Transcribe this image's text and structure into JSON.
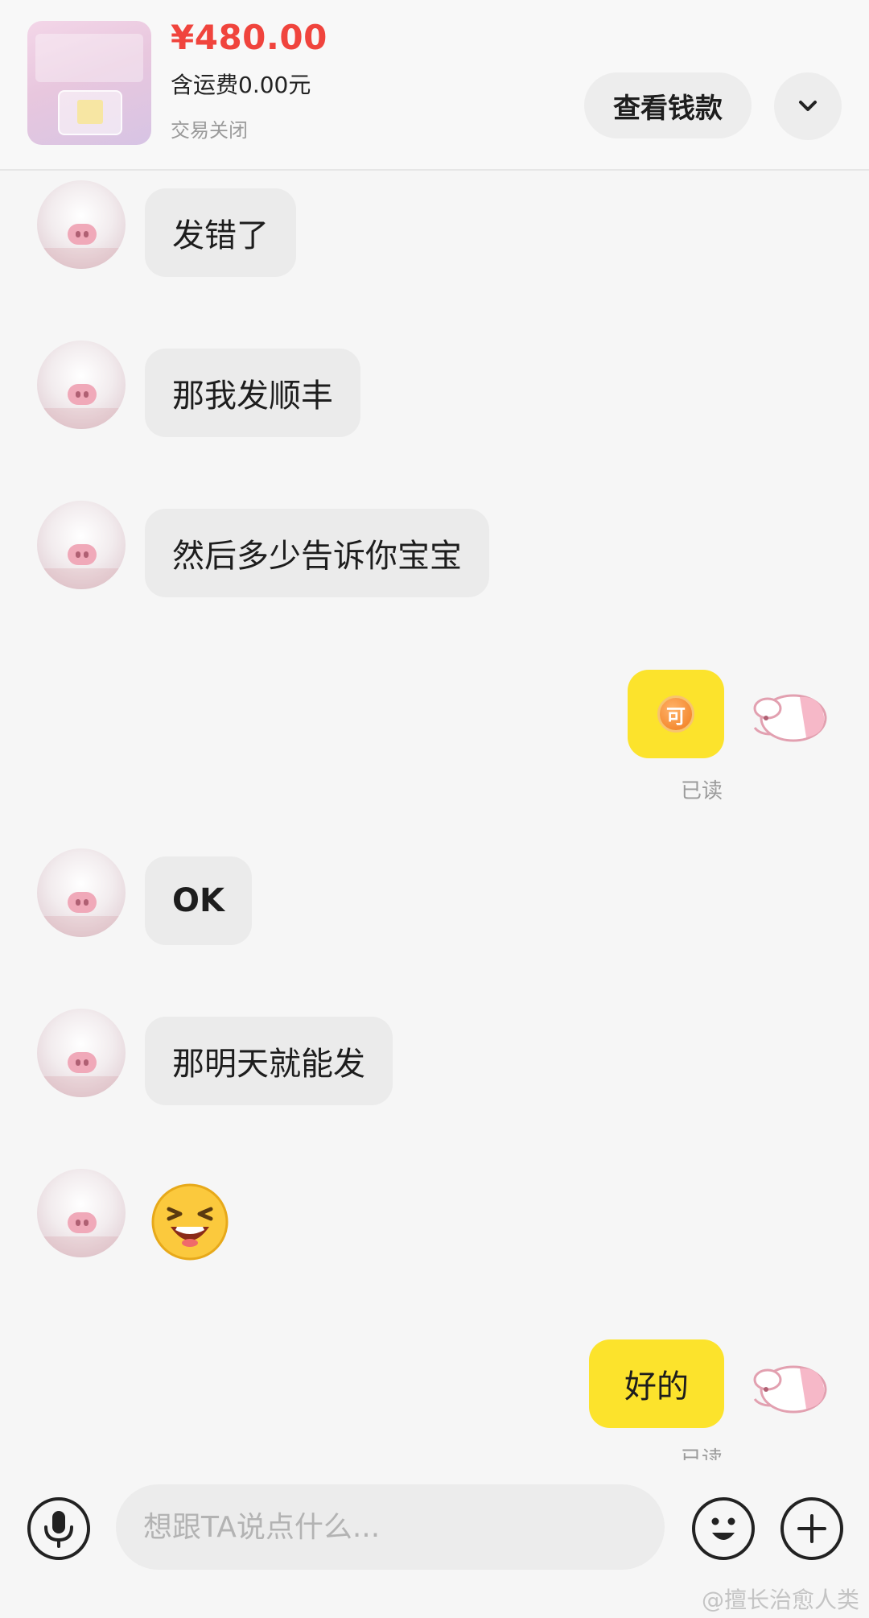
{
  "order": {
    "price": "¥480.00",
    "shipping": "含运费0.00元",
    "status": "交易关闭",
    "view_button": "查看钱款"
  },
  "messages": [
    {
      "side": "left",
      "type": "text",
      "text": "发错了"
    },
    {
      "side": "left",
      "type": "text",
      "text": "那我发顺丰"
    },
    {
      "side": "left",
      "type": "text",
      "text": "然后多少告诉你宝宝"
    },
    {
      "side": "right",
      "type": "sticker",
      "sticker_glyph": "可",
      "read": "已读"
    },
    {
      "side": "left",
      "type": "text",
      "text": "OK"
    },
    {
      "side": "left",
      "type": "text",
      "text": "那明天就能发"
    },
    {
      "side": "left",
      "type": "emoji",
      "emoji": "laughing-emoji"
    },
    {
      "side": "right",
      "type": "text",
      "text": "好的",
      "read": "已读"
    }
  ],
  "input": {
    "placeholder": "想跟TA说点什么..."
  },
  "icons": {
    "mic": "microphone-icon",
    "emoji": "smiley-icon",
    "plus": "plus-icon",
    "expand": "chevron-down-icon"
  },
  "colors": {
    "price": "#f0443d",
    "bubble_self": "#fce32c",
    "bubble_other": "#ebebeb"
  },
  "watermark": "@擅长治愈人类"
}
